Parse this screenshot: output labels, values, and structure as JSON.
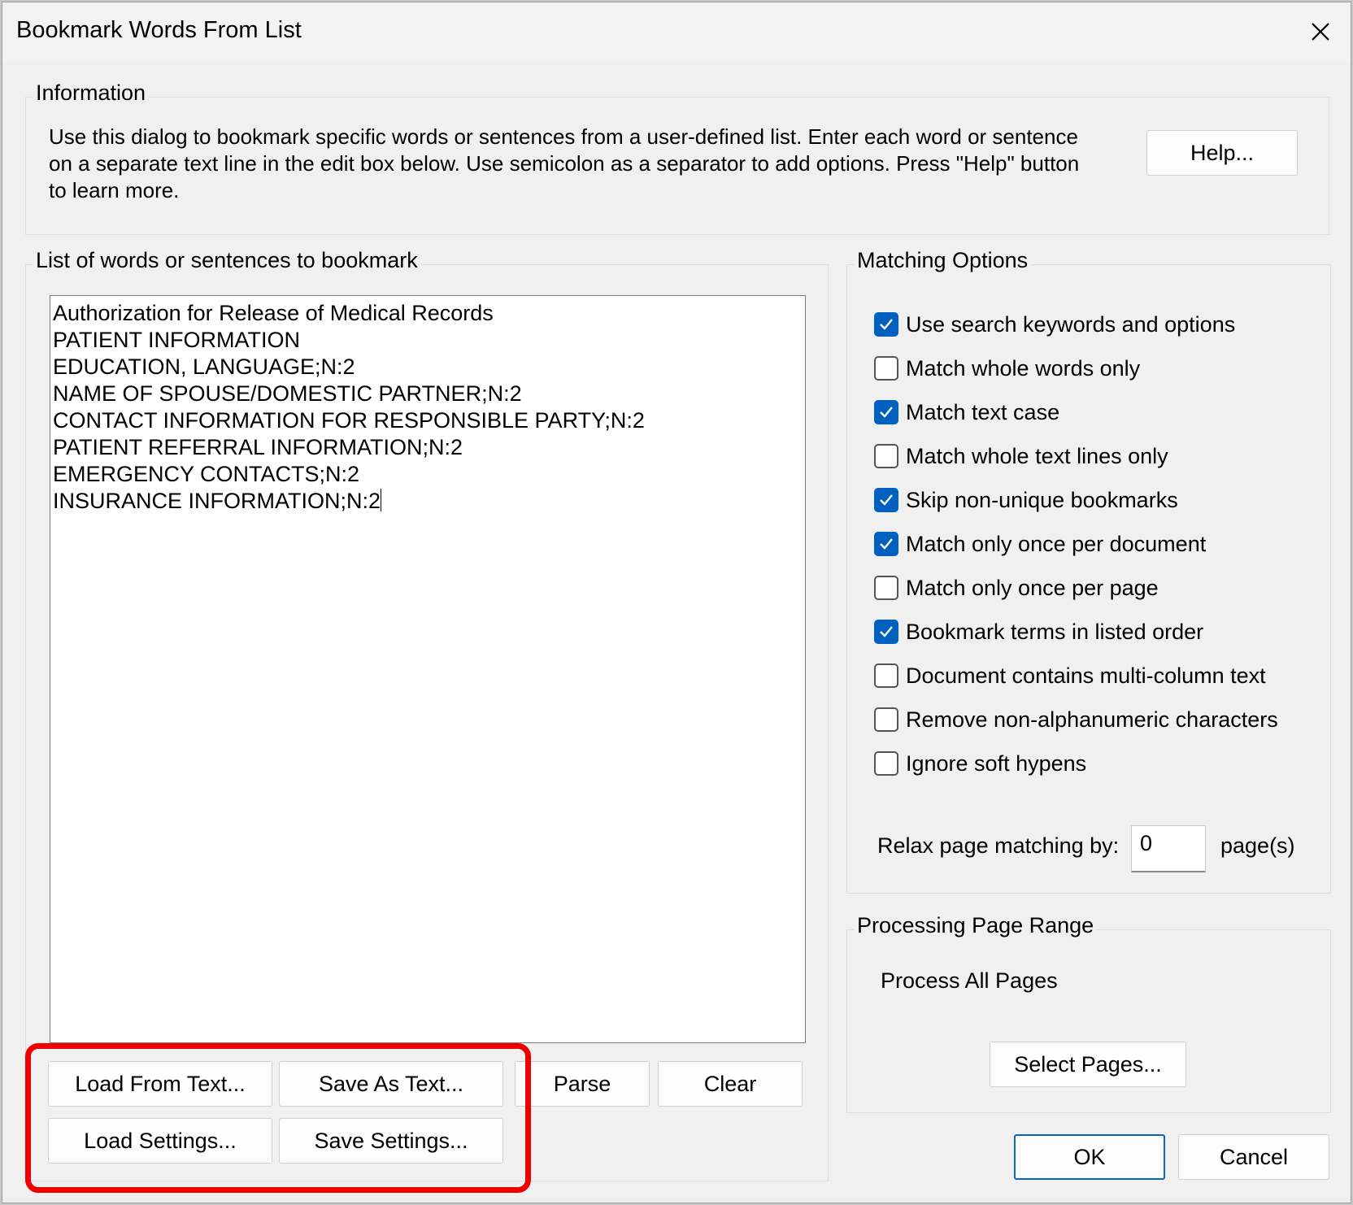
{
  "window": {
    "title": "Bookmark Words From List"
  },
  "information": {
    "label": "Information",
    "text": "Use this dialog to bookmark specific words or sentences from a user-defined list. Enter each word or sentence on a separate text line in the edit box below. Use semicolon as a separator to add options. Press \"Help\" button to learn more.",
    "help_button": "Help..."
  },
  "list": {
    "label": "List of words or sentences to bookmark",
    "lines": [
      "Authorization for Release of Medical Records",
      "PATIENT INFORMATION",
      "EDUCATION, LANGUAGE;N:2",
      "NAME OF SPOUSE/DOMESTIC PARTNER;N:2",
      "CONTACT INFORMATION FOR RESPONSIBLE PARTY;N:2",
      "PATIENT REFERRAL INFORMATION;N:2",
      "EMERGENCY CONTACTS;N:2",
      "INSURANCE INFORMATION;N:2"
    ],
    "buttons": {
      "load_text": "Load From Text...",
      "save_text": "Save As Text...",
      "parse": "Parse",
      "clear": "Clear",
      "load_settings": "Load Settings...",
      "save_settings": "Save Settings..."
    }
  },
  "matching": {
    "label": "Matching Options",
    "options": [
      {
        "label": "Use search keywords and options",
        "checked": true
      },
      {
        "label": "Match whole words only",
        "checked": false
      },
      {
        "label": "Match text case",
        "checked": true
      },
      {
        "label": "Match whole text lines only",
        "checked": false
      },
      {
        "label": "Skip non-unique bookmarks",
        "checked": true
      },
      {
        "label": "Match only once per document",
        "checked": true
      },
      {
        "label": "Match only once per page",
        "checked": false
      },
      {
        "label": "Bookmark terms in listed order",
        "checked": true
      },
      {
        "label": "Document contains multi-column text",
        "checked": false
      },
      {
        "label": "Remove non-alphanumeric characters",
        "checked": false
      },
      {
        "label": "Ignore soft hypens",
        "checked": false
      }
    ],
    "relax_label": "Relax page matching by:",
    "relax_value": "0",
    "relax_suffix": "page(s)"
  },
  "range": {
    "label": "Processing Page Range",
    "value": "Process All Pages",
    "select_button": "Select Pages..."
  },
  "footer": {
    "ok": "OK",
    "cancel": "Cancel"
  },
  "colors": {
    "accent": "#0060c0",
    "highlight": "#ee0000"
  }
}
